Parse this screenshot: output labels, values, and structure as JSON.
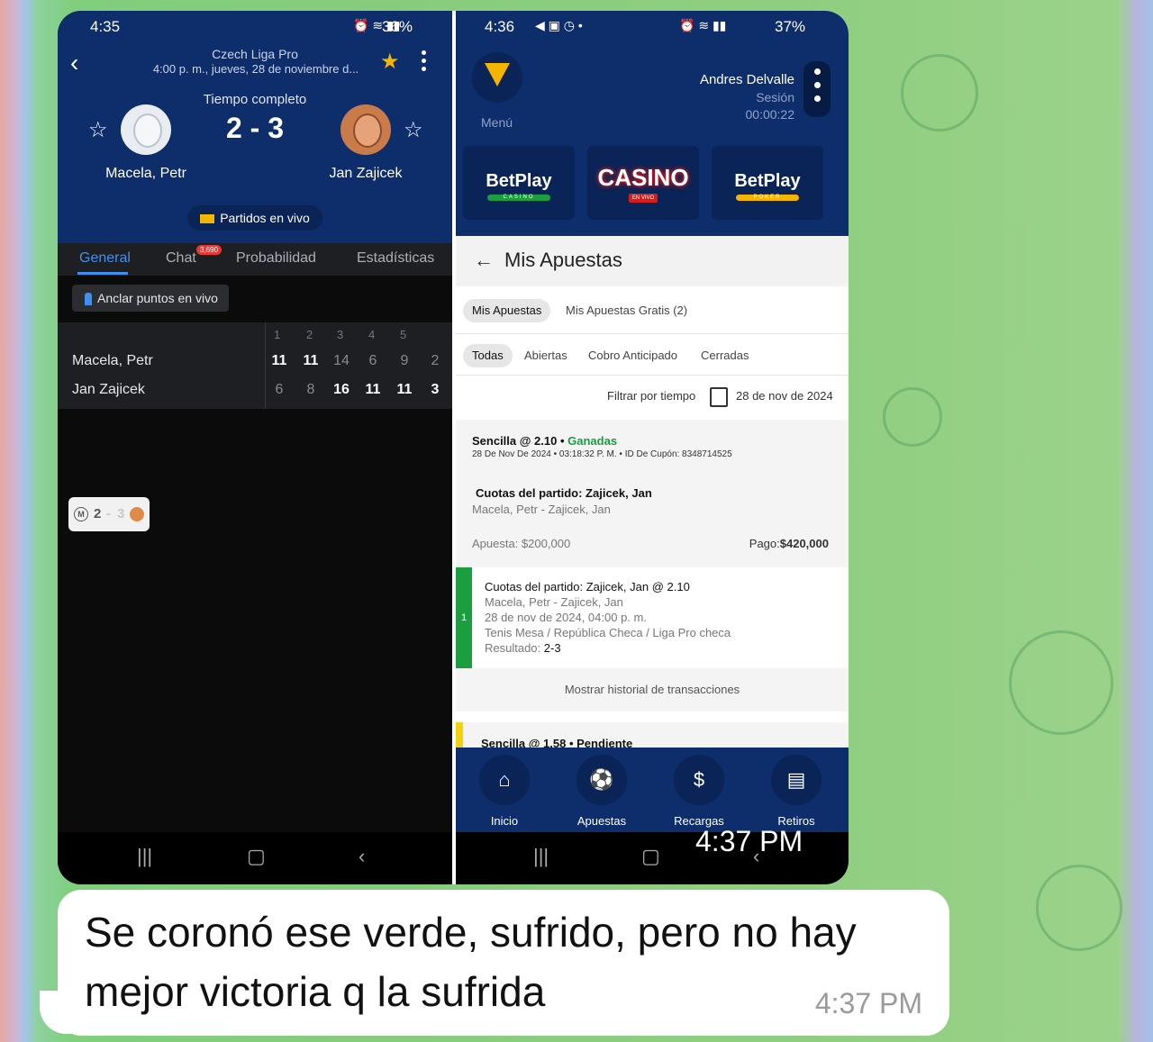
{
  "left_screen": {
    "status_time": "4:35",
    "battery": "36%",
    "league": "Czech Liga Pro",
    "datetime": "4:00 p. m., jueves, 28 de noviembre d...",
    "match_status": "Tiempo completo",
    "score": "2 - 3",
    "player_home": "Macela, Petr",
    "player_away": "Jan Zajicek",
    "live_button": "Partidos en vivo",
    "tabs": [
      "General",
      "Chat",
      "Probabilidad",
      "Estadísticas"
    ],
    "chat_badge": "3,690",
    "pin_button": "Anclar puntos en vivo",
    "set_headers": [
      "1",
      "2",
      "3",
      "4",
      "5"
    ],
    "rows": [
      {
        "name": "Macela, Petr",
        "scores": [
          "11",
          "11",
          "14",
          "6",
          "9",
          "2"
        ]
      },
      {
        "name": "Jan Zajicek",
        "scores": [
          "6",
          "8",
          "16",
          "11",
          "11",
          "3"
        ]
      }
    ],
    "mini_widget": {
      "m": "M",
      "home": "2",
      "sep": "-",
      "away": "3"
    }
  },
  "right_screen": {
    "status_time": "4:36",
    "battery": "37%",
    "menu_label": "Menú",
    "user_name": "Andres Delvalle",
    "session_label": "Sesión",
    "session_time": "00:00:22",
    "cards": [
      {
        "title": "BetPlay",
        "sub": "CASINO",
        "color": "#1a9e3f"
      },
      {
        "title": "CASINO",
        "sub": "EN VIVO",
        "color": "#d81b1b"
      },
      {
        "title": "BetPlay",
        "sub": "POKER",
        "color": "#f5b400"
      }
    ],
    "page_title": "Mis Apuestas",
    "top_pills": [
      "Mis Apuestas",
      "Mis Apuestas Gratis (2)"
    ],
    "filter_pills": [
      "Todas",
      "Abiertas",
      "Cobro Anticipado",
      "Cerradas"
    ],
    "filter_label": "Filtrar por tiempo",
    "filter_date": "28 de nov de 2024",
    "bet": {
      "type": "Sencilla @ 2.10 •",
      "status": "Ganadas",
      "meta": "28 De Nov De 2024 • 03:18:32 P. M. • ID De Cupón: 8348714525",
      "market": "Cuotas del partido: Zajicek, Jan",
      "match": "Macela, Petr - Zajicek, Jan",
      "stake_label": "Apuesta:",
      "stake": "$200,000",
      "payout_label": "Pago:",
      "payout": "$420,000"
    },
    "selection": {
      "index": "1",
      "market": "Cuotas del partido: Zajicek, Jan @ 2.10",
      "match": "Macela, Petr - Zajicek, Jan",
      "date": "28 de nov de 2024, 04:00 p. m.",
      "league": "Tenis Mesa / República Checa / Liga Pro checa",
      "result_label": "Resultado:",
      "result": "2-3"
    },
    "history_link": "Mostrar historial de transacciones",
    "bet2": "Sencilla @ 1.58 • Pendiente",
    "bottom_nav": [
      "Inicio",
      "Apuestas",
      "Recargas",
      "Retiros"
    ],
    "image_timestamp": "4:37 PM"
  },
  "message": {
    "text": "Se coronó ese verde, sufrido, pero no hay mejor victoria q la sufrida",
    "time": "4:37 PM"
  }
}
